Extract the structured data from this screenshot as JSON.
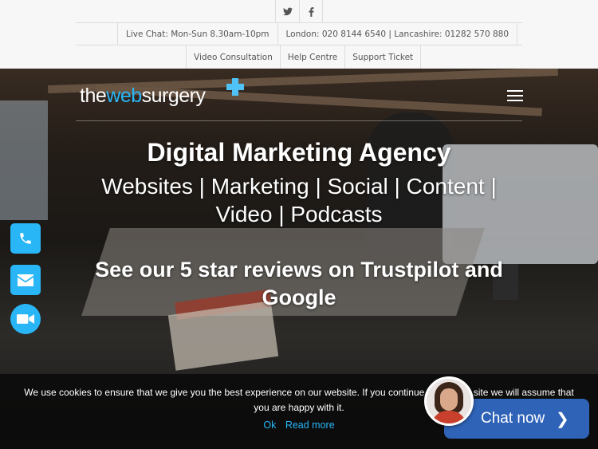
{
  "topbar": {
    "social": [
      {
        "icon": "twitter-icon",
        "glyph": "𝕥"
      },
      {
        "icon": "facebook-icon",
        "glyph": "f"
      }
    ],
    "contact": [
      "Live Chat: Mon-Sun 8.30am-10pm",
      "London: 020 8144 6540 | Lancashire: 01282 570 880"
    ],
    "links": [
      "Video Consultation",
      "Help Centre",
      "Support Ticket"
    ]
  },
  "header": {
    "logo_pre": "the",
    "logo_accent": "web",
    "logo_post": "surgery"
  },
  "hero": {
    "title": "Digital Marketing Agency",
    "subtitle": "Websites | Marketing | Social | Content | Video | Podcasts",
    "reviews": "See our 5 star reviews on Trustpilot and Google"
  },
  "side_buttons": [
    {
      "icon": "phone-icon"
    },
    {
      "icon": "email-icon"
    },
    {
      "icon": "video-camera-icon"
    }
  ],
  "cookie": {
    "text": "We use cookies to ensure that we give you the best experience on our website. If you continue to use this site we will assume that you are happy with it.",
    "ok": "Ok",
    "read_more": "Read more",
    "close": "✕"
  },
  "chat": {
    "label": "Chat now",
    "chevron": "❯"
  },
  "colors": {
    "accent": "#29b6f6",
    "chat_blue": "#2f63b7"
  }
}
